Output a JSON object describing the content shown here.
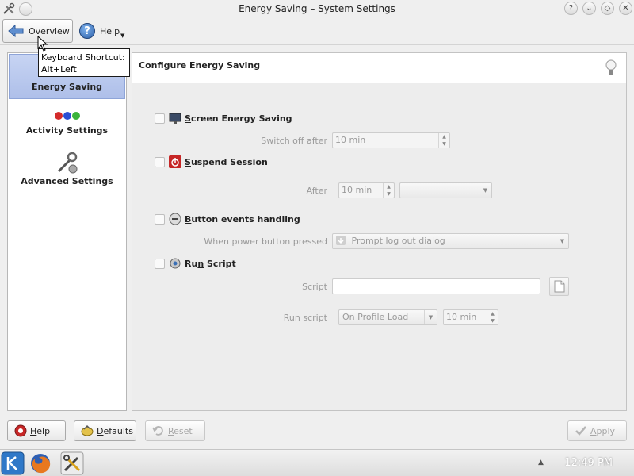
{
  "window": {
    "title": "Energy Saving – System Settings",
    "controls": [
      "?",
      "⌄",
      "◇",
      "✕"
    ]
  },
  "toolbar": {
    "overview_label": "Overview",
    "help_label": "Help"
  },
  "tooltip": {
    "line1": "Keyboard Shortcut:",
    "line2": "Alt+Left"
  },
  "sidebar": {
    "items": [
      {
        "label": "Energy Saving",
        "selected": true,
        "icon": "energy-saving-icon"
      },
      {
        "label": "Activity Settings",
        "selected": false,
        "icon": "activity-dots-icon"
      },
      {
        "label": "Advanced Settings",
        "selected": false,
        "icon": "tools-icon"
      }
    ]
  },
  "main": {
    "header_title": "Configure Energy Saving",
    "sections": {
      "screen": {
        "label_prefix": "",
        "label_underlined": "S",
        "label_rest": "creen Energy Saving",
        "switch_off_label": "Switch off after",
        "switch_off_value": "10 min"
      },
      "suspend": {
        "label_underlined": "S",
        "label_rest": "uspend Session",
        "after_label": "After",
        "after_value": "10 min",
        "after_action": ""
      },
      "button_events": {
        "label_underlined": "B",
        "label_rest": "utton events handling",
        "power_button_label": "When power button pressed",
        "power_button_value": "Prompt log out dialog"
      },
      "run_script": {
        "label_prefix": "Ru",
        "label_underlined": "n",
        "label_rest": " Script",
        "script_label": "Script",
        "script_value": "",
        "run_script_label": "Run script",
        "run_script_value": "On Profile Load",
        "run_script_time": "10 min"
      }
    }
  },
  "footer": {
    "help_underlined": "H",
    "help_rest": "elp",
    "defaults_underlined": "D",
    "defaults_rest": "efaults",
    "reset_underlined": "R",
    "reset_rest": "eset",
    "apply_underlined": "A",
    "apply_rest": "pply"
  },
  "taskbar": {
    "clock": "12:49 PM"
  },
  "colors": {
    "selection": "#b9c8ef",
    "accent_blue": "#2c5fa8"
  }
}
